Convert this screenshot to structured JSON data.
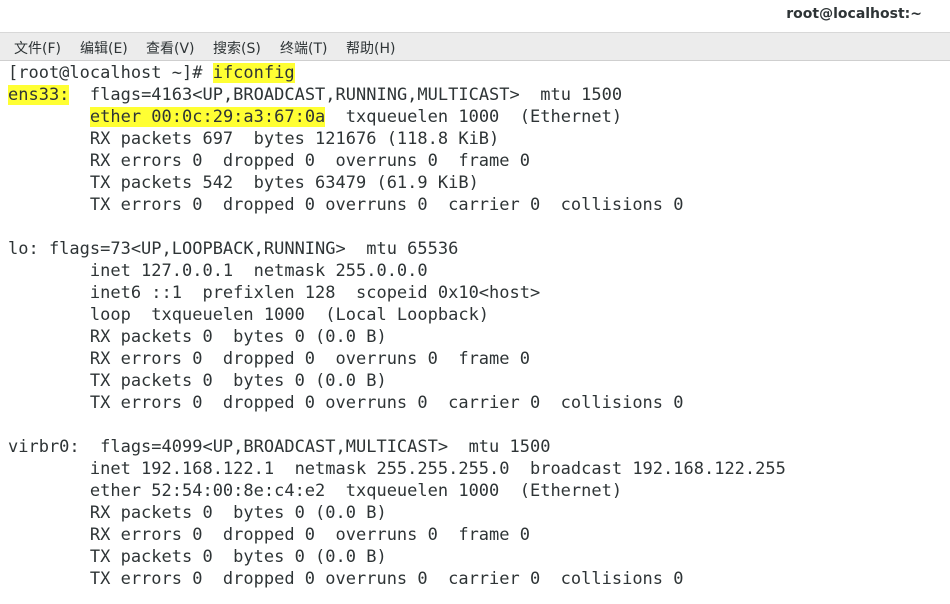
{
  "window": {
    "title": "root@localhost:~"
  },
  "menu": [
    {
      "label": "文件(F)"
    },
    {
      "label": "编辑(E)"
    },
    {
      "label": "查看(V)"
    },
    {
      "label": "搜索(S)"
    },
    {
      "label": "终端(T)"
    },
    {
      "label": "帮助(H)"
    }
  ],
  "terminal": {
    "prompt": "[root@localhost ~]# ",
    "command": "ifconfig",
    "iface1": {
      "name": "ens33:",
      "flags": "  flags=4163<UP,BROADCAST,RUNNING,MULTICAST>  mtu 1500",
      "indent": "        ",
      "ether": "ether 00:0c:29:a3:67:0a",
      "ether_rest": "  txqueuelen 1000  (Ethernet)",
      "rx_packets": "        RX packets 697  bytes 121676 (118.8 KiB)",
      "rx_errors": "        RX errors 0  dropped 0  overruns 0  frame 0",
      "tx_packets": "        TX packets 542  bytes 63479 (61.9 KiB)",
      "tx_errors": "        TX errors 0  dropped 0 overruns 0  carrier 0  collisions 0"
    },
    "iface2": {
      "header": "lo: flags=73<UP,LOOPBACK,RUNNING>  mtu 65536",
      "inet": "        inet 127.0.0.1  netmask 255.0.0.0",
      "inet6": "        inet6 ::1  prefixlen 128  scopeid 0x10<host>",
      "loop": "        loop  txqueuelen 1000  (Local Loopback)",
      "rx_packets": "        RX packets 0  bytes 0 (0.0 B)",
      "rx_errors": "        RX errors 0  dropped 0  overruns 0  frame 0",
      "tx_packets": "        TX packets 0  bytes 0 (0.0 B)",
      "tx_errors": "        TX errors 0  dropped 0 overruns 0  carrier 0  collisions 0"
    },
    "iface3": {
      "header": "virbr0:  flags=4099<UP,BROADCAST,MULTICAST>  mtu 1500",
      "inet": "        inet 192.168.122.1  netmask 255.255.255.0  broadcast 192.168.122.255",
      "ether": "        ether 52:54:00:8e:c4:e2  txqueuelen 1000  (Ethernet)",
      "rx_packets": "        RX packets 0  bytes 0 (0.0 B)",
      "rx_errors": "        RX errors 0  dropped 0  overruns 0  frame 0",
      "tx_packets": "        TX packets 0  bytes 0 (0.0 B)",
      "tx_errors": "        TX errors 0  dropped 0 overruns 0  carrier 0  collisions 0"
    }
  },
  "colors": {
    "highlight": "#ffff33",
    "text": "#2e3436",
    "menubar_bg": "#ececec"
  }
}
